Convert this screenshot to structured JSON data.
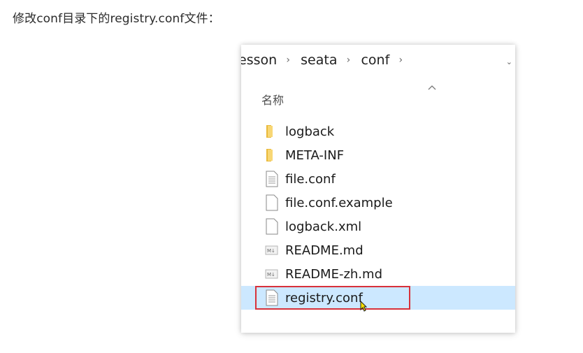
{
  "intro_text": "修改conf目录下的registry.conf文件：",
  "explorer": {
    "breadcrumb": [
      "esson",
      "seata",
      "conf"
    ],
    "column_header": "名称",
    "files": [
      {
        "name": "logback",
        "icon": "folder-icon",
        "selected": false
      },
      {
        "name": "META-INF",
        "icon": "folder-icon",
        "selected": false
      },
      {
        "name": "file.conf",
        "icon": "text-file-icon",
        "selected": false
      },
      {
        "name": "file.conf.example",
        "icon": "blank-file-icon",
        "selected": false
      },
      {
        "name": "logback.xml",
        "icon": "blank-file-icon",
        "selected": false
      },
      {
        "name": "README.md",
        "icon": "markdown-file-icon",
        "selected": false
      },
      {
        "name": "README-zh.md",
        "icon": "markdown-file-icon",
        "selected": false
      },
      {
        "name": "registry.conf",
        "icon": "text-file-icon",
        "selected": true
      }
    ],
    "colors": {
      "selection_bg": "#cce8ff",
      "highlight_border": "#d8313a",
      "folder": "#f5c94c"
    }
  }
}
